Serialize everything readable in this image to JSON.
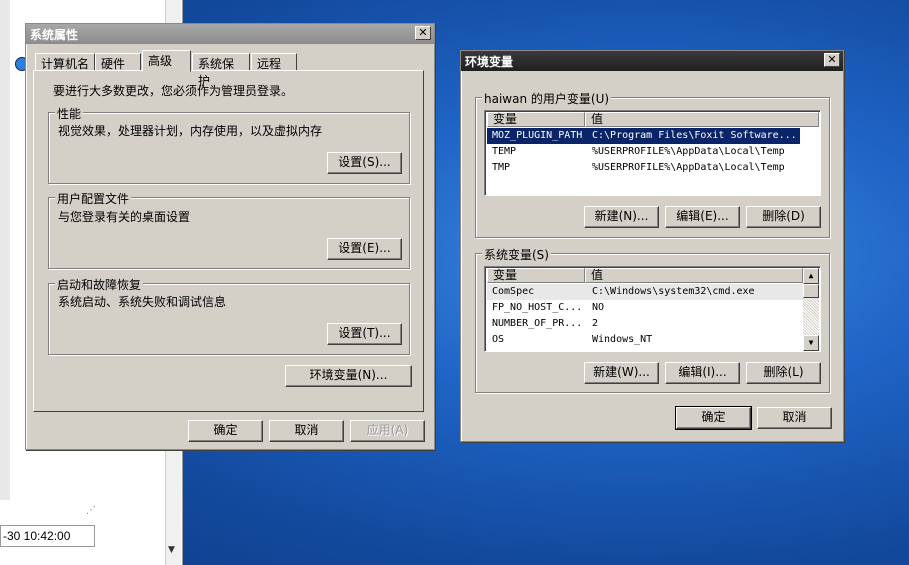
{
  "background_window": {
    "datetime_text": "-30 10:42:00"
  },
  "sysprops": {
    "title": "系统属性",
    "close_glyph": "✕",
    "tabs": [
      "计算机名",
      "硬件",
      "高级",
      "系统保护",
      "远程"
    ],
    "admin_note": "要进行大多数更改，您必须作为管理员登录。",
    "performance": {
      "legend": "性能",
      "desc": "视觉效果，处理器计划，内存使用，以及虚拟内存",
      "button": "设置(S)..."
    },
    "profiles": {
      "legend": "用户配置文件",
      "desc": "与您登录有关的桌面设置",
      "button": "设置(E)..."
    },
    "startup": {
      "legend": "启动和故障恢复",
      "desc": "系统启动、系统失败和调试信息",
      "button": "设置(T)..."
    },
    "env_button": "环境变量(N)...",
    "ok": "确定",
    "cancel": "取消",
    "apply": "应用(A)"
  },
  "envvars": {
    "title": "环境变量",
    "close_glyph": "✕",
    "user_group": "haiwan 的用户变量(U)",
    "col_var": "变量",
    "col_val": "值",
    "user_rows": [
      {
        "name": "MOZ_PLUGIN_PATH",
        "value": "C:\\Program Files\\Foxit Software..."
      },
      {
        "name": "TEMP",
        "value": "%USERPROFILE%\\AppData\\Local\\Temp"
      },
      {
        "name": "TMP",
        "value": "%USERPROFILE%\\AppData\\Local\\Temp"
      }
    ],
    "user_new": "新建(N)...",
    "user_edit": "编辑(E)...",
    "user_delete": "删除(D)",
    "sys_group": "系统变量(S)",
    "sys_rows": [
      {
        "name": "ComSpec",
        "value": "C:\\Windows\\system32\\cmd.exe"
      },
      {
        "name": "FP_NO_HOST_C...",
        "value": "NO"
      },
      {
        "name": "NUMBER_OF_PR...",
        "value": "2"
      },
      {
        "name": "OS",
        "value": "Windows_NT"
      }
    ],
    "sys_new": "新建(W)...",
    "sys_edit": "编辑(I)...",
    "sys_delete": "删除(L)",
    "ok": "确定",
    "cancel": "取消"
  }
}
